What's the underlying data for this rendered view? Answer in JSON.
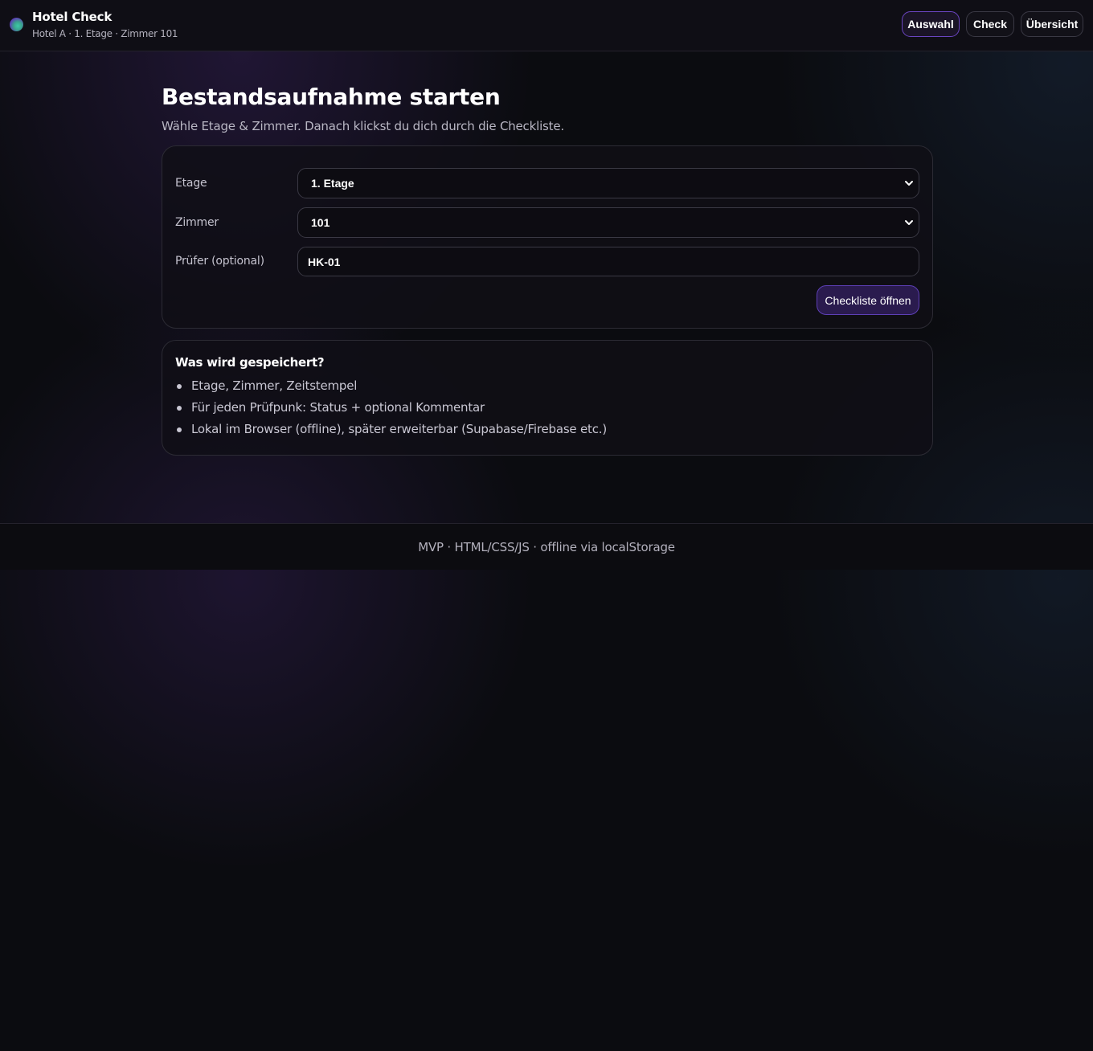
{
  "header": {
    "title": "Hotel Check",
    "subtitle": "Hotel A · 1. Etage · Zimmer 101",
    "nav": {
      "auswahl": "Auswahl",
      "check": "Check",
      "uebersicht": "Übersicht"
    },
    "active_nav": "Auswahl"
  },
  "main": {
    "title": "Bestandsaufnahme starten",
    "subtitle": "Wähle Etage & Zimmer. Danach klickst du dich durch die Checkliste."
  },
  "form": {
    "etage_label": "Etage",
    "etage_value": "1. Etage",
    "zimmer_label": "Zimmer",
    "zimmer_value": "101",
    "pruefer_label": "Prüfer (optional)",
    "pruefer_value": "HK-01",
    "submit_label": "Checkliste öffnen"
  },
  "info": {
    "title": "Was wird gespeichert?",
    "items": [
      "Etage, Zimmer, Zeitstempel",
      "Für jeden Prüfpunk: Status + optional Kommentar",
      "Lokal im Browser (offline), später erweiterbar (Supabase/Firebase etc.)"
    ]
  },
  "footer": {
    "text": "MVP · HTML/CSS/JS · offline via localStorage"
  },
  "colors": {
    "accent": "#6b45c2",
    "accent_bg": "#2a1b4e",
    "background": "#0b0c10"
  },
  "icons": {
    "brand": "brand-logo-icon",
    "select_arrow": "chevron-down-icon"
  }
}
